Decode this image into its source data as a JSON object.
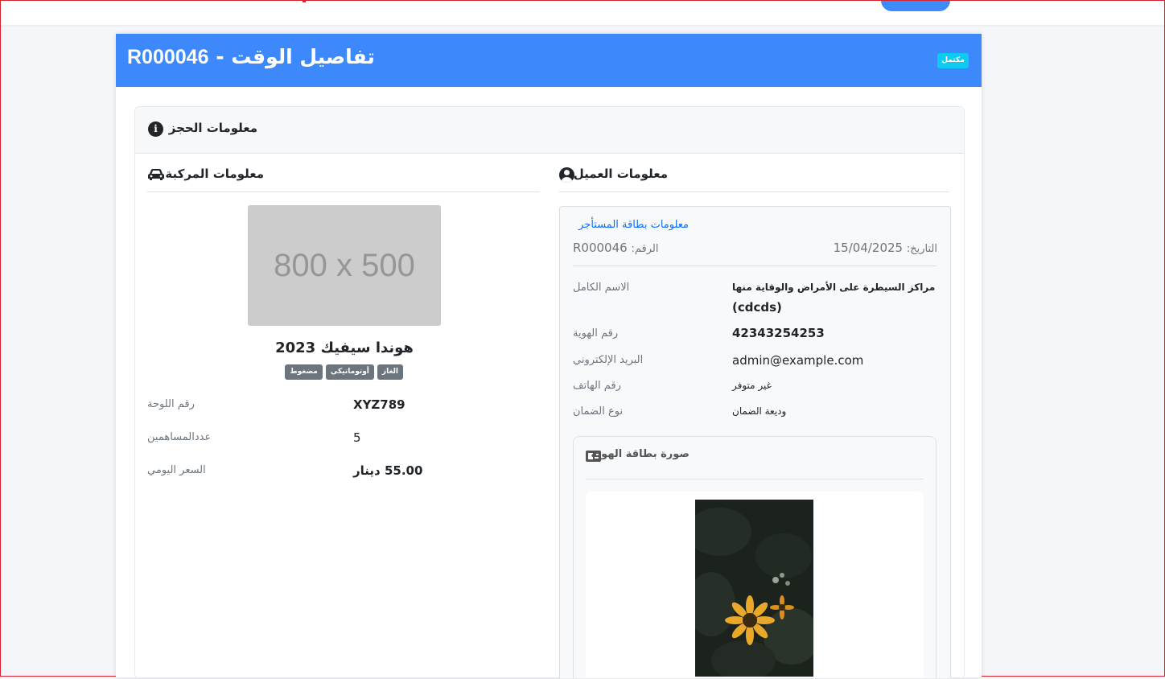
{
  "header": {
    "title_text": "تفاصيل الوقت - ",
    "booking_id": "R000046",
    "status": "مكتمل"
  },
  "booking_section": {
    "title": "معلومات الحجز"
  },
  "vehicle": {
    "section_title": "معلومات المركبة",
    "image_placeholder": "800 x 500",
    "name": "هوندا سيفيك 2023",
    "tags": [
      "الغاز",
      "أوتوماتيكي",
      "مضغوط"
    ],
    "fields": [
      {
        "label": "رقم اللوحة",
        "value": "XYZ789"
      },
      {
        "label": "عددالمساهمين",
        "value": "5"
      },
      {
        "label": "السعر اليومي",
        "value": "55.00 دينار"
      }
    ]
  },
  "customer": {
    "section_title": "معلومات العميل",
    "card_title": "معلومات بطاقة المستأجر",
    "number_label": "الرقم:",
    "number_value": "R000046",
    "date_label": "التاريخ:",
    "date_value": "15/04/2025",
    "fields": [
      {
        "label": "الاسم الكامل",
        "value": "مراكز السيطرة على الأمراض والوقاية منها",
        "value2": "(cdcds)"
      },
      {
        "label": "رقم الهوية",
        "value": "42343254253"
      },
      {
        "label": "البريد الإلكتروني",
        "value": "admin@example.com"
      },
      {
        "label": "رقم الهاتف",
        "value": "غير متوفر"
      },
      {
        "label": "نوع الضمان",
        "value": "وديعة الضمان"
      }
    ],
    "id_card_title": "صورة بطاقة الهوية"
  }
}
